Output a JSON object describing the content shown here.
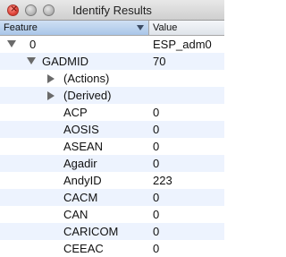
{
  "window": {
    "title": "Identify Results"
  },
  "header": {
    "feature": "Feature",
    "value": "Value"
  },
  "rows": [
    {
      "feature": "0",
      "value": "ESP_adm0"
    },
    {
      "feature": "GADMID",
      "value": "70"
    },
    {
      "feature": "(Actions)",
      "value": ""
    },
    {
      "feature": "(Derived)",
      "value": ""
    },
    {
      "feature": "ACP",
      "value": "0"
    },
    {
      "feature": "AOSIS",
      "value": "0"
    },
    {
      "feature": "ASEAN",
      "value": "0"
    },
    {
      "feature": "Agadir",
      "value": "0"
    },
    {
      "feature": "AndyID",
      "value": "223"
    },
    {
      "feature": "CACM",
      "value": "0"
    },
    {
      "feature": "CAN",
      "value": "0"
    },
    {
      "feature": "CARICOM",
      "value": "0"
    },
    {
      "feature": "CEEAC",
      "value": "0"
    }
  ]
}
